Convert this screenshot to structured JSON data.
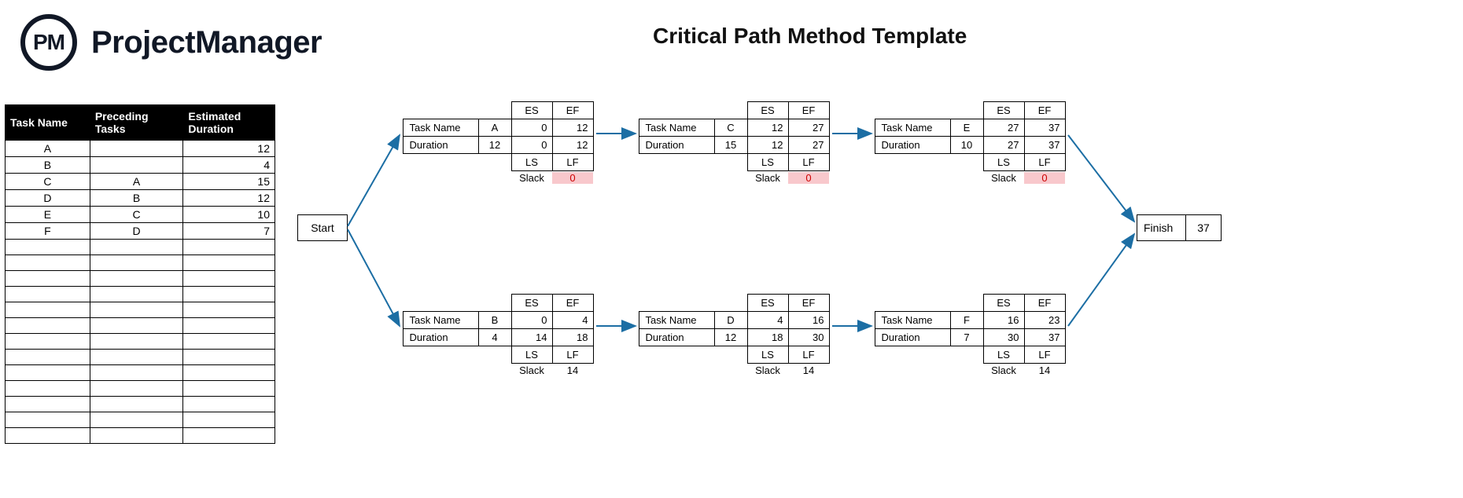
{
  "brand": {
    "logo": "PM",
    "name": "ProjectManager"
  },
  "title": "Critical Path Method Template",
  "table": {
    "headers": {
      "name": "Task Name",
      "pred": "Preceding Tasks",
      "dur": "Estimated Duration"
    },
    "rows": [
      {
        "name": "A",
        "pred": "",
        "dur": "12"
      },
      {
        "name": "B",
        "pred": "",
        "dur": "4"
      },
      {
        "name": "C",
        "pred": "A",
        "dur": "15"
      },
      {
        "name": "D",
        "pred": "B",
        "dur": "12"
      },
      {
        "name": "E",
        "pred": "C",
        "dur": "10"
      },
      {
        "name": "F",
        "pred": "D",
        "dur": "7"
      }
    ],
    "blank_rows": 13
  },
  "start": {
    "label": "Start"
  },
  "finish": {
    "label": "Finish",
    "value": "37"
  },
  "node_labels": {
    "task": "Task Name",
    "dur": "Duration",
    "es": "ES",
    "ef": "EF",
    "ls": "LS",
    "lf": "LF",
    "slack": "Slack"
  },
  "nodes": {
    "A": {
      "name": "A",
      "dur": "12",
      "es": "0",
      "ef": "12",
      "ls": "0",
      "lf": "12",
      "slack": "0",
      "critical": true
    },
    "B": {
      "name": "B",
      "dur": "4",
      "es": "0",
      "ef": "4",
      "ls": "14",
      "lf": "18",
      "slack": "14",
      "critical": false
    },
    "C": {
      "name": "C",
      "dur": "15",
      "es": "12",
      "ef": "27",
      "ls": "12",
      "lf": "27",
      "slack": "0",
      "critical": true
    },
    "D": {
      "name": "D",
      "dur": "12",
      "es": "4",
      "ef": "16",
      "ls": "18",
      "lf": "30",
      "slack": "14",
      "critical": false
    },
    "E": {
      "name": "E",
      "dur": "10",
      "es": "27",
      "ef": "37",
      "ls": "27",
      "lf": "37",
      "slack": "0",
      "critical": true
    },
    "F": {
      "name": "F",
      "dur": "7",
      "es": "16",
      "ef": "23",
      "ls": "30",
      "lf": "37",
      "slack": "14",
      "critical": false
    }
  }
}
